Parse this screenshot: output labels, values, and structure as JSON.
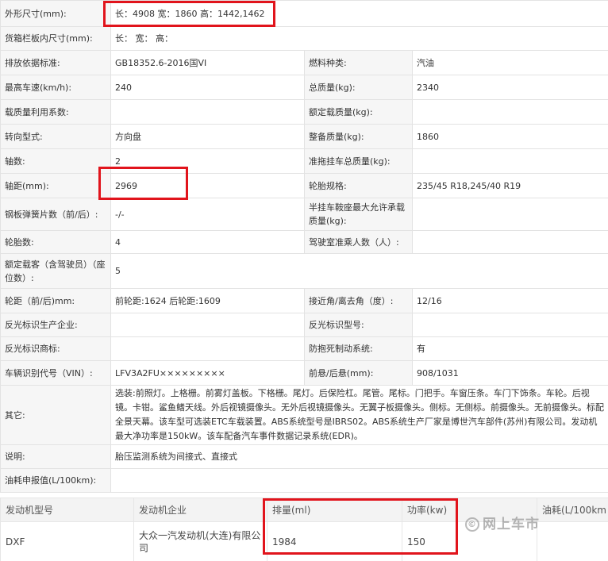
{
  "specs": {
    "dims": {
      "label": "外形尺寸(mm):",
      "value": "长：4908 宽：1860 高：1442,1462"
    },
    "cargo": {
      "label": "货箱栏板内尺寸(mm):",
      "value": "长：  宽：  高："
    },
    "r3": {
      "l1": "排放依据标准:",
      "v1": "GB18352.6-2016国VI",
      "l2": "燃料种类:",
      "v2": "汽油"
    },
    "r4": {
      "l1": "最高车速(km/h):",
      "v1": "240",
      "l2": "总质量(kg):",
      "v2": "2340"
    },
    "r5": {
      "l1": "载质量利用系数:",
      "v1": "",
      "l2": "额定载质量(kg):",
      "v2": ""
    },
    "r6": {
      "l1": "转向型式:",
      "v1": "方向盘",
      "l2": "整备质量(kg):",
      "v2": "1860"
    },
    "r7": {
      "l1": "轴数:",
      "v1": "2",
      "l2": "准拖挂车总质量(kg):",
      "v2": ""
    },
    "r8": {
      "l1": "轴距(mm):",
      "v1": "2969",
      "l2": "轮胎规格:",
      "v2": "235/45 R18,245/40 R19"
    },
    "r9": {
      "l1": "钢板弹簧片数（前/后）:",
      "v1": "-/-",
      "l2": "半挂车鞍座最大允许承载质量(kg):",
      "v2": ""
    },
    "r10": {
      "l1": "轮胎数:",
      "v1": "4",
      "l2": "驾驶室准乘人数（人）:",
      "v2": ""
    },
    "r11": {
      "l1": "额定载客（含驾驶员）（座位数）:",
      "v1": "5"
    },
    "r12": {
      "l1": "轮距（前/后)mm:",
      "v1": "前轮距:1624 后轮距:1609",
      "l2": "接近角/离去角（度）:",
      "v2": "12/16"
    },
    "r13": {
      "l1": "反光标识生产企业:",
      "v1": "",
      "l2": "反光标识型号:",
      "v2": ""
    },
    "r14": {
      "l1": "反光标识商标:",
      "v1": "",
      "l2": "防抱死制动系统:",
      "v2": "有"
    },
    "r15": {
      "l1": "车辆识别代号（VIN）:",
      "v1": "LFV3A2FU×××××××××",
      "l2": "前悬/后悬(mm):",
      "v2": "908/1031"
    },
    "other": {
      "label": "其它:",
      "value": "选装:前照灯。上格栅。前雾灯盖板。下格栅。尾灯。后保险杠。尾管。尾标。门把手。车窗压条。车门下饰条。车轮。后视镜。卡钳。鲨鱼鳍天线。外后视镜摄像头。无外后视镜摄像头。无翼子板摄像头。侧标。无侧标。前摄像头。无前摄像头。标配全景天幕。该车型可选装ETC车载装置。ABS系统型号是IBRS02。ABS系统生产厂家是博世汽车部件(苏州)有限公司。发动机最大净功率是150kW。该车配备汽车事件数据记录系统(EDR)。"
    },
    "note": {
      "label": "说明:",
      "value": "胎压监测系统为间接式、直接式"
    },
    "fuel": {
      "label": "油耗申报值(L/100km):",
      "value": ""
    }
  },
  "engine": {
    "headers": {
      "model": "发动机型号",
      "maker": "发动机企业",
      "displacement": "排量(ml)",
      "power": "功率(kw)",
      "fuel": "油耗(L/100km"
    },
    "row": {
      "model": "DXF",
      "maker": "大众一汽发动机(大连)有限公司",
      "displacement": "1984",
      "power": "150",
      "fuel": ""
    }
  },
  "watermark": {
    "text": "网上车市",
    "mark": "©"
  },
  "colors": {
    "highlight": "#e1141c",
    "label_bg": "#f6f6f6",
    "border": "#e3e3e3"
  }
}
